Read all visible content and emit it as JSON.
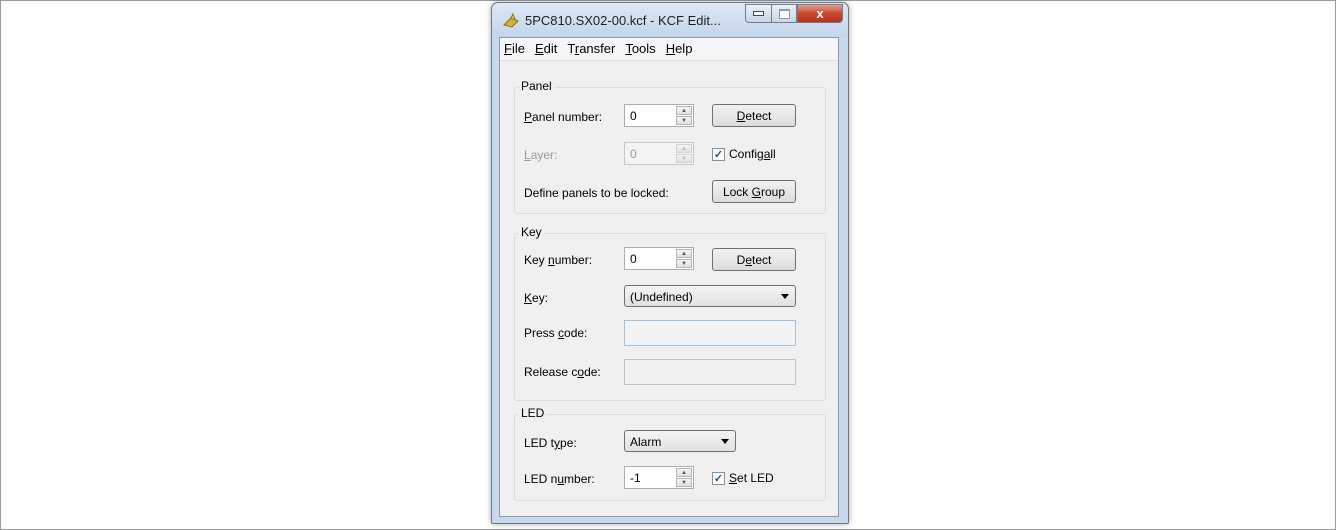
{
  "window": {
    "title": "5PC810.SX02-00.kcf - KCF Edit...",
    "close_glyph": "x"
  },
  "menu": {
    "items": [
      {
        "mnemonic": "F",
        "rest": "ile"
      },
      {
        "mnemonic": "E",
        "rest": "dit"
      },
      {
        "pre": "T",
        "mnemonic": "r",
        "rest": "ansfer"
      },
      {
        "mnemonic": "T",
        "rest": "ools"
      },
      {
        "mnemonic": "H",
        "rest": "elp"
      }
    ]
  },
  "panel": {
    "group_label": "Panel",
    "panel_number_label_m": "P",
    "panel_number_label_rest": "anel number:",
    "panel_number_value": "0",
    "detect_label_m": "D",
    "detect_label_rest": "etect",
    "layer_label_m": "L",
    "layer_label_rest": "ayer:",
    "layer_value": "0",
    "config_all_pre": "Config ",
    "config_all_m": "a",
    "config_all_rest": "ll",
    "config_all_checked": true,
    "lock_prompt": "Define panels to be locked:",
    "lock_group_pre": "Lock ",
    "lock_group_m": "G",
    "lock_group_rest": "roup"
  },
  "key": {
    "group_label": "Key",
    "key_number_pre": "Key ",
    "key_number_m": "n",
    "key_number_rest": "umber:",
    "key_number_value": "0",
    "detect_pre": "D",
    "detect_m": "e",
    "detect_rest": "tect",
    "key_label_m": "K",
    "key_label_rest": "ey:",
    "key_value": "(Undefined)",
    "press_pre": "Press ",
    "press_m": "c",
    "press_rest": "ode:",
    "press_code": "",
    "release_pre": "Release c",
    "release_m": "o",
    "release_rest": "de:",
    "release_code": ""
  },
  "led": {
    "group_label": "LED",
    "type_pre": "LED t",
    "type_m": "y",
    "type_rest": "pe:",
    "type_value": "Alarm",
    "number_pre": "LED n",
    "number_m": "u",
    "number_rest": "mber:",
    "number_value": "-1",
    "set_led_m": "S",
    "set_led_rest": "et LED",
    "set_led_checked": true
  }
}
